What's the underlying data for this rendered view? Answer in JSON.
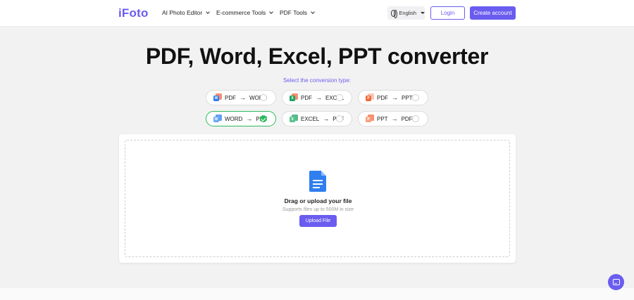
{
  "header": {
    "logo": "iFoto",
    "nav": [
      {
        "label": "AI Photo Editor"
      },
      {
        "label": "E-commerce Tools"
      },
      {
        "label": "PDF Tools"
      }
    ],
    "language": "English",
    "login_label": "Login",
    "create_account_label": "Create account"
  },
  "main": {
    "title": "PDF, Word, Excel, PPT converter",
    "subtitle": "Select the conversion type:",
    "conversion_options": [
      {
        "from": "PDF",
        "to": "WORD",
        "icon": "pdf-to-word-icon",
        "selected": false
      },
      {
        "from": "PDF",
        "to": "EXCEL",
        "icon": "pdf-to-excel-icon",
        "selected": false
      },
      {
        "from": "PDF",
        "to": "PPT",
        "icon": "pdf-to-ppt-icon",
        "selected": false
      },
      {
        "from": "WORD",
        "to": "PDF",
        "icon": "word-to-pdf-icon",
        "selected": true
      },
      {
        "from": "EXCEL",
        "to": "PDF",
        "icon": "excel-to-pdf-icon",
        "selected": false
      },
      {
        "from": "PPT",
        "to": "PDF",
        "icon": "ppt-to-pdf-icon",
        "selected": false
      }
    ],
    "upload": {
      "drag_text": "Drag or upload your file",
      "support_text": "Supports files up to 500M in size",
      "button_label": "Upload File"
    }
  },
  "colors": {
    "accent": "#6b5cf0",
    "selected_border": "#2dbb5d",
    "word": "#2f7ff0",
    "excel": "#21a366",
    "ppt": "#f26a3d"
  }
}
